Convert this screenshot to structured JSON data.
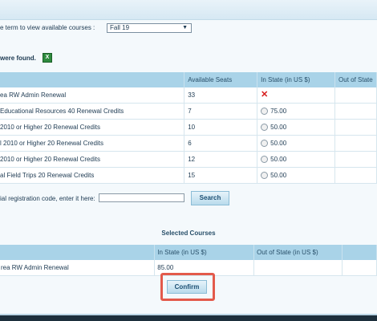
{
  "term": {
    "label": "e term to view available courses :",
    "selected": "Fall 19"
  },
  "results": {
    "found_text": "were found."
  },
  "courses_table": {
    "headers": [
      "",
      "Available Seats",
      "In State (in US $)",
      "Out of State"
    ],
    "rows": [
      {
        "name": "ea RW Admin Renewal",
        "seats": "33",
        "price": ""
      },
      {
        "name": "Educational Resources 40 Renewal Credits",
        "seats": "7",
        "price": "75.00"
      },
      {
        "name": "2010 or Higher 20 Renewal Credits",
        "seats": "10",
        "price": "50.00"
      },
      {
        "name": "l 2010 or Higher 20 Renewal Credits",
        "seats": "6",
        "price": "50.00"
      },
      {
        "name": "2010 or Higher 20 Renewal Credits",
        "seats": "12",
        "price": "50.00"
      },
      {
        "name": "al Field Trips 20 Renewal Credits",
        "seats": "15",
        "price": "50.00"
      }
    ]
  },
  "registration": {
    "label": "ial registration code, enter it here:",
    "value": "",
    "search_label": "Search"
  },
  "selected_courses": {
    "title": "Selected Courses",
    "headers": [
      "",
      "In State (in US $)",
      "Out of State (in US $)",
      ""
    ],
    "rows": [
      {
        "name": "rea RW Admin Renewal",
        "in_state": "85.00",
        "out_state": ""
      }
    ]
  },
  "confirm_label": "Confirm",
  "icons": {
    "remove": "remove-icon",
    "excel": "excel-icon"
  },
  "colors": {
    "header_bg": "#a9d3e8",
    "highlight_border": "#e35a4b"
  }
}
